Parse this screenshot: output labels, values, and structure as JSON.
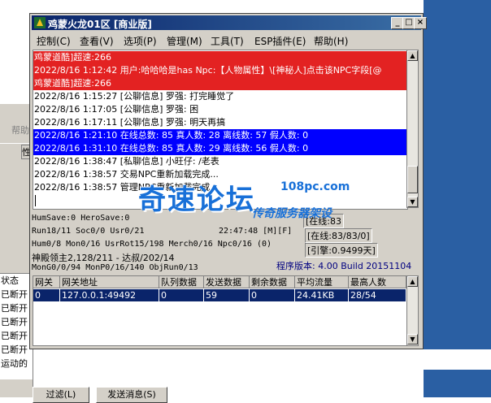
{
  "window": {
    "title": "鸡蒙火龙01区 [商业版]",
    "controls": {
      "minimize": "_",
      "maximize": "□",
      "close": "×"
    }
  },
  "menu": [
    "控制(C)",
    "查看(V)",
    "选项(P)",
    "管理(M)",
    "工具(T)",
    "ESP插件(E)",
    "帮助(H)"
  ],
  "log_lines": [
    {
      "text": "鸡蒙道酷]超速:266",
      "style": "red"
    },
    {
      "text": "2022/8/16 1:12:42 用户:哈哈哈是has Npc:【人物属性】\\[神秘人]点击该NPC字段[@",
      "style": "red"
    },
    {
      "text": "鸡蒙道酷]超速:266",
      "style": "red"
    },
    {
      "text": "2022/8/16 1:15:27 [公聊信息] 罗强: 打完睡觉了",
      "style": "normal"
    },
    {
      "text": "2022/8/16 1:17:05 [公聊信息] 罗强: 困",
      "style": "normal"
    },
    {
      "text": "2022/8/16 1:17:11 [公聊信息] 罗强: 明天再搞",
      "style": "normal"
    },
    {
      "text": "2022/8/16 1:21:10 在线总数: 85 真人数: 28 离线数: 57 假人数: 0",
      "style": "blue"
    },
    {
      "text": "2022/8/16 1:31:10 在线总数: 85 真人数: 29 离线数: 56 假人数: 0",
      "style": "blue"
    },
    {
      "text": "2022/8/16 1:38:47 [私聊信息] 小旺仔: /老表",
      "style": "normal"
    },
    {
      "text": "2022/8/16 1:38:57 交易NPC重新加载完成...",
      "style": "normal"
    },
    {
      "text": "2022/8/16 1:38:57 管理NPC重新加载完成...",
      "style": "normal"
    }
  ],
  "status": {
    "line1": "HumSave:0 HeroSave:0",
    "line2": "Run18/11 Soc0/0 Usr0/21",
    "time": "22:47:48 [M][F]",
    "line3": "Hum0/8 Mon0/16 UsrRot15/198 Merch0/16 Npc0/16 (0)",
    "line4": "神殿领主2,128/211 - 达叔/202/14",
    "line5": "MonG0/0/94 MonP0/16/140 ObjRun0/13",
    "online_label": "[在线:83/83/0]",
    "online_partial": "[在线:83",
    "engine": "[引擎:0.9499天]",
    "version": "程序版本: 4.00 Build 20151104"
  },
  "watermark": {
    "title": "奇速论坛",
    "url": "108pc.com",
    "subtitle": "传奇服务器架设"
  },
  "table": {
    "headers": [
      "网关",
      "网关地址",
      "队列数据",
      "发送数据",
      "剩余数据",
      "平均流量",
      "最高人数"
    ],
    "rows": [
      [
        "0",
        "127.0.0.1:49492",
        "0",
        "59",
        "0",
        "24.41KB",
        "28/54"
      ]
    ]
  },
  "bg_window": {
    "menu_label": "帮助",
    "tab_label": "性",
    "list": [
      "状态",
      "已断开",
      "已断开",
      "已断开",
      "已断开",
      "已断开",
      "运动的"
    ],
    "buttons": [
      "过滤(L)",
      "发送消息(S)"
    ]
  }
}
